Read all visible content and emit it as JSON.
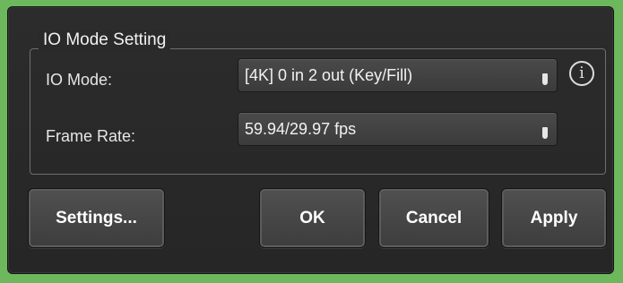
{
  "group": {
    "title": "IO Mode Setting"
  },
  "io_mode": {
    "label": "IO Mode:",
    "value": "[4K] 0 in 2 out (Key/Fill)",
    "icon": "info-icon"
  },
  "frame_rate": {
    "label": "Frame Rate:",
    "value": "59.94/29.97 fps"
  },
  "buttons": {
    "settings": "Settings...",
    "ok": "OK",
    "cancel": "Cancel",
    "apply": "Apply"
  },
  "colors": {
    "window_border": "#6db85c",
    "background": "#2a2a2a",
    "button": "#474747"
  }
}
